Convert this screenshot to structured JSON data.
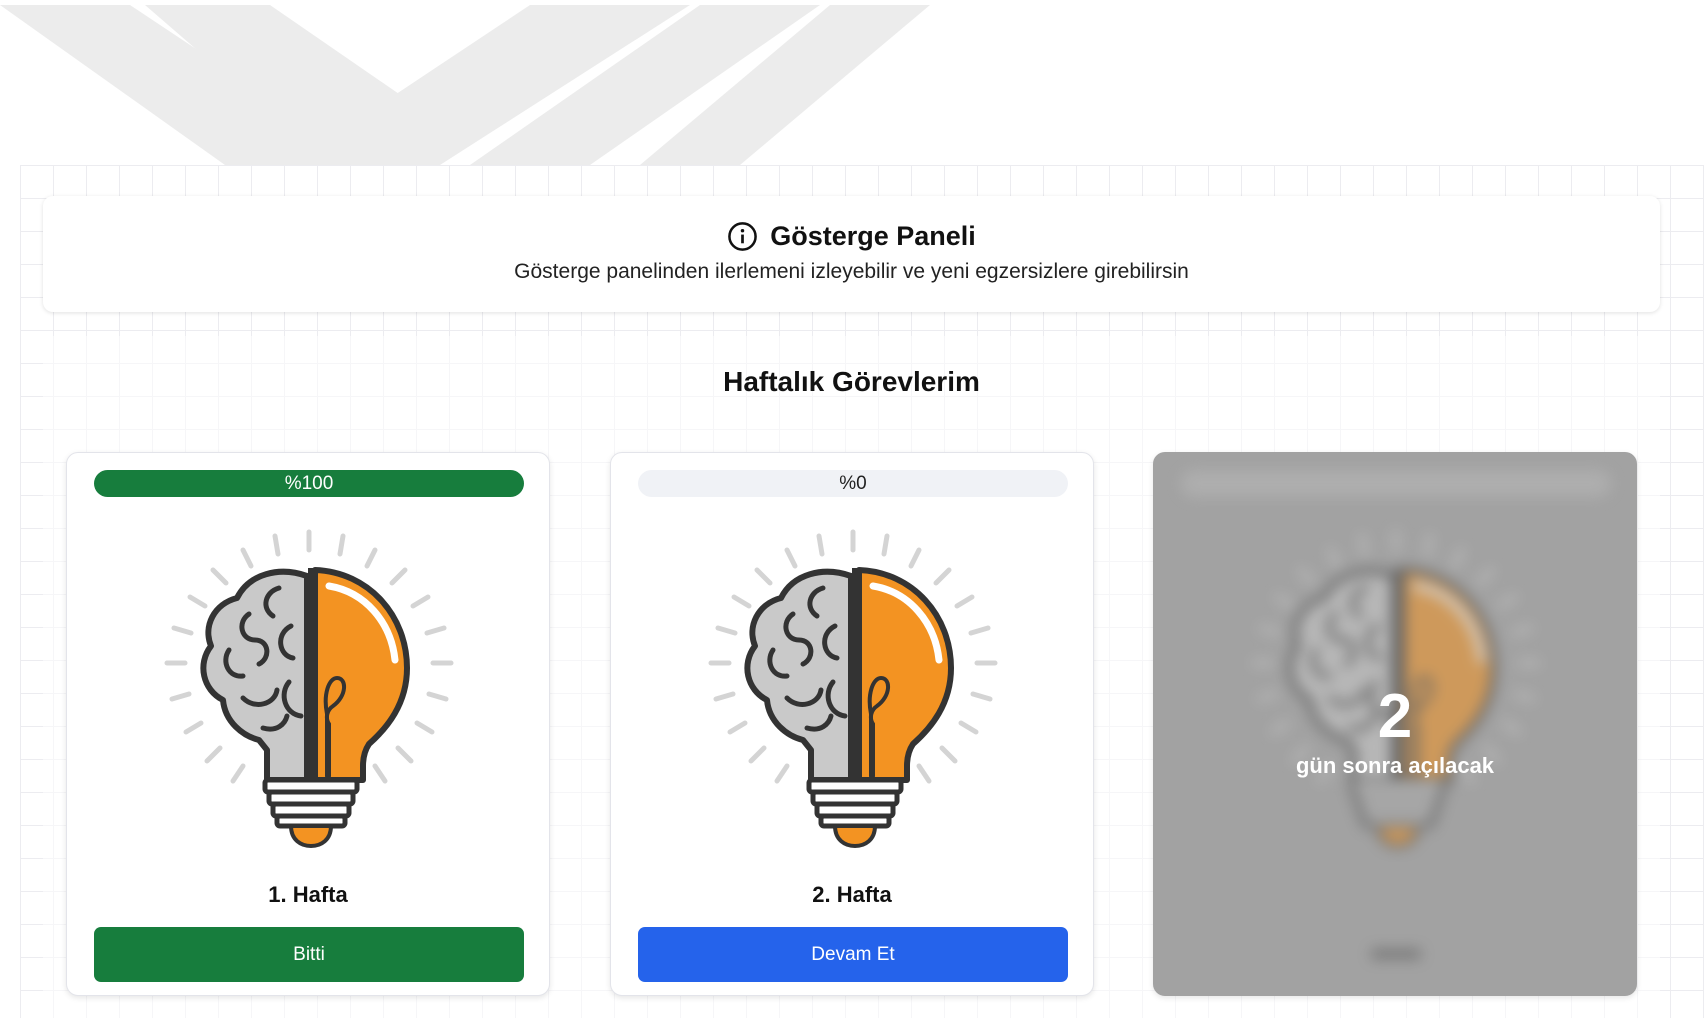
{
  "header": {
    "title": "Gösterge Paneli",
    "subtitle": "Gösterge panelinden ilerlemeni izleyebilir ve yeni egzersizlere girebilirsin",
    "icon": "info-icon"
  },
  "tasks": {
    "title": "Haftalık Görevlerim",
    "cards": [
      {
        "week": "1. Hafta",
        "progress_text": "%100",
        "progress": 100,
        "button": "Bitti",
        "status_color": "#177d3d"
      },
      {
        "week": "2. Hafta",
        "progress_text": "%0",
        "progress": 0,
        "button": "Devam Et",
        "status_color": "#2563eb"
      },
      {
        "locked": true,
        "lock_count": "2",
        "lock_text": "gün sonra açılacak"
      }
    ]
  },
  "colors": {
    "done_green": "#177d3d",
    "continue_blue": "#2563eb",
    "bulb_orange": "#f39322",
    "brain_gray": "#c8c8c8",
    "locked_overlay": "#a2a2a2"
  }
}
